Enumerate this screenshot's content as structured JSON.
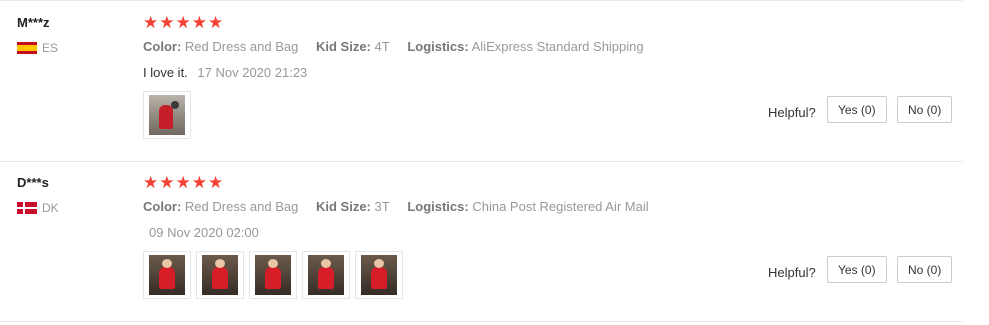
{
  "reviews": [
    {
      "user": "M***z",
      "country": "ES",
      "stars": "★★★★★",
      "color_label": "Color:",
      "color_value": "Red Dress and Bag",
      "size_label": "Kid Size:",
      "size_value": "4T",
      "logistics_label": "Logistics:",
      "logistics_value": "AliExpress Standard Shipping",
      "comment": "I love it.",
      "date": "17 Nov 2020 21:23",
      "helpful_label": "Helpful?",
      "yes_label": "Yes (0)",
      "no_label": "No (0)",
      "photo_count": 1
    },
    {
      "user": "D***s",
      "country": "DK",
      "stars": "★★★★★",
      "color_label": "Color:",
      "color_value": "Red Dress and Bag",
      "size_label": "Kid Size:",
      "size_value": "3T",
      "logistics_label": "Logistics:",
      "logistics_value": "China Post Registered Air Mail",
      "comment": "",
      "date": "09 Nov 2020 02:00",
      "helpful_label": "Helpful?",
      "yes_label": "Yes (0)",
      "no_label": "No (0)",
      "photo_count": 5
    }
  ],
  "colors": {
    "star": "#f44336",
    "muted": "#999999",
    "divider": "#e8e8e8"
  }
}
